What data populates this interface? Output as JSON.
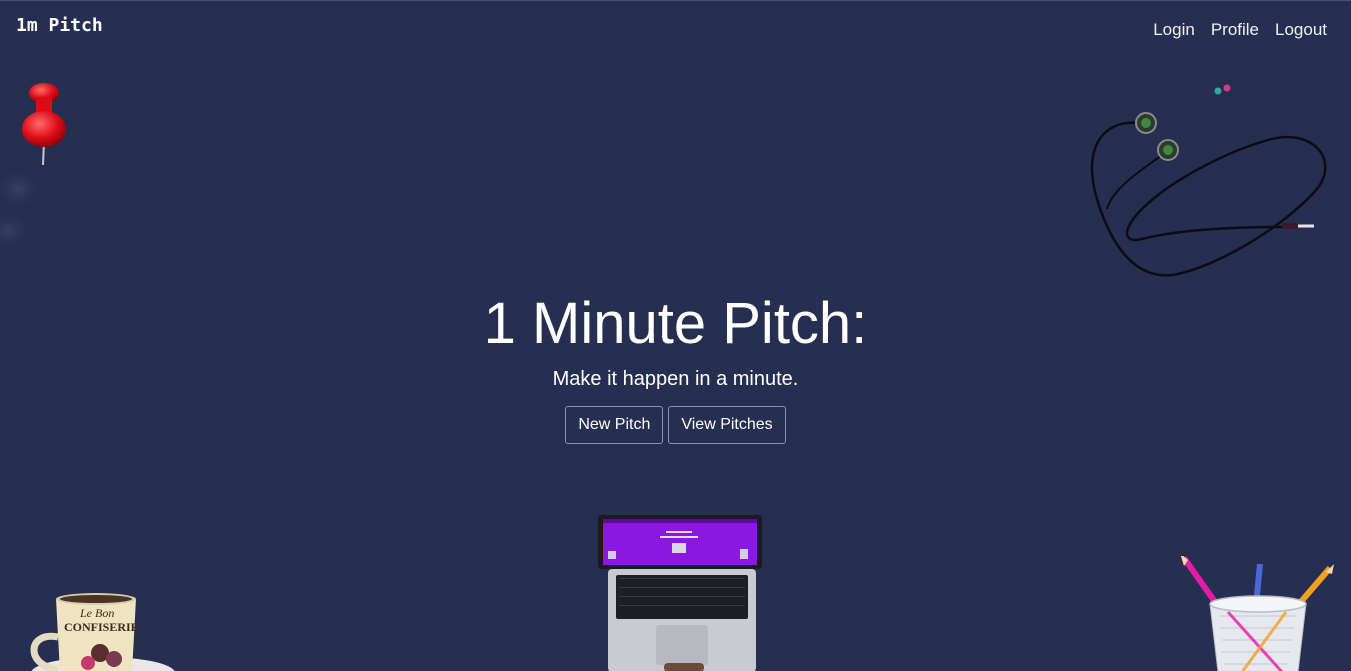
{
  "navbar": {
    "brand": "1m Pitch",
    "links": [
      {
        "label": "Login"
      },
      {
        "label": "Profile"
      },
      {
        "label": "Logout"
      }
    ]
  },
  "hero": {
    "title": "1 Minute Pitch:",
    "subtitle": "Make it happen in a minute.",
    "buttons": [
      {
        "label": "New Pitch"
      },
      {
        "label": "View Pitches"
      }
    ]
  },
  "decorations": {
    "mug_text_line1": "Le Bon",
    "mug_text_line2": "CONFISERIE"
  },
  "colors": {
    "background": "#262f51",
    "text": "#ffffff",
    "button_border": "#8b91aa"
  }
}
